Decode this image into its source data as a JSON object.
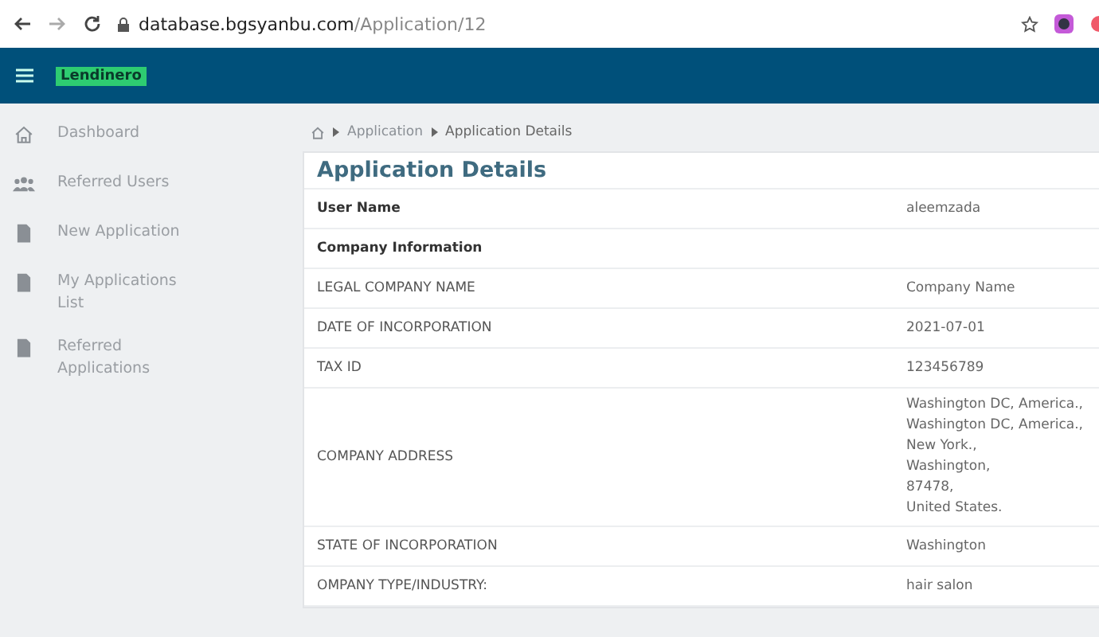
{
  "browser": {
    "url_host": "database.bgsyanbu.com",
    "url_path": "/Application/12"
  },
  "header": {
    "logo": "Lendinero"
  },
  "sidebar": {
    "items": [
      {
        "kind": "home",
        "label": "Dashboard"
      },
      {
        "kind": "users",
        "label": "Referred Users"
      },
      {
        "kind": "doc",
        "label": "New Application"
      },
      {
        "kind": "doc",
        "label": "My Applications List"
      },
      {
        "kind": "doc",
        "label": "Referred Applications"
      }
    ]
  },
  "breadcrumb": [
    "Application",
    "Application Details"
  ],
  "card": {
    "title": "Application Details",
    "rows": [
      {
        "kind": "bold",
        "label": "User Name",
        "value_lines": [
          "aleemzada"
        ]
      },
      {
        "kind": "bold",
        "label": "Company Information"
      },
      {
        "kind": "normal",
        "label": "LEGAL COMPANY NAME",
        "value_lines": [
          "Company Name"
        ]
      },
      {
        "kind": "normal",
        "label": "DATE OF INCORPORATION",
        "value_lines": [
          "2021-07-01"
        ]
      },
      {
        "kind": "normal",
        "label": "TAX ID",
        "value_lines": [
          "123456789"
        ]
      },
      {
        "kind": "normal",
        "label": "COMPANY ADDRESS",
        "value_lines": [
          "Washington DC, America.,",
          "Washington DC, America.,",
          "New York.,",
          "Washington,",
          "87478,",
          "United States."
        ]
      },
      {
        "kind": "normal",
        "label": "STATE OF INCORPORATION",
        "value_lines": [
          "Washington"
        ]
      },
      {
        "kind": "normal",
        "label": "OMPANY TYPE/INDUSTRY:",
        "value_lines": [
          "hair salon"
        ]
      }
    ]
  }
}
